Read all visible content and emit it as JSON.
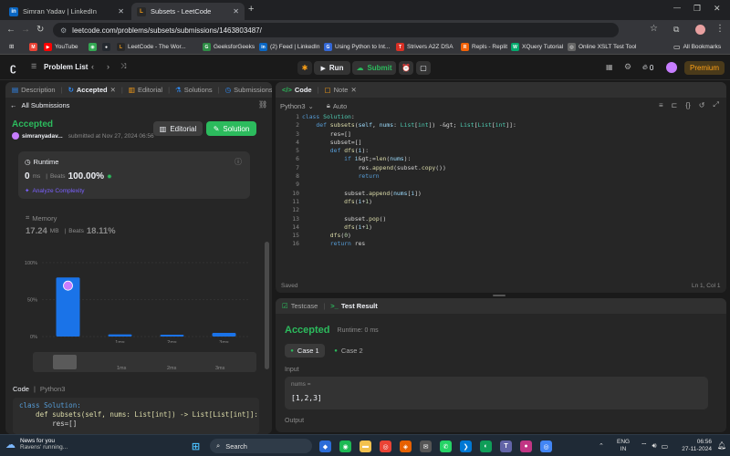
{
  "browser": {
    "tabs": [
      {
        "icon": "in",
        "title": "Simran Yadav | LinkedIn"
      },
      {
        "icon": "leetcode",
        "title": "Subsets - LeetCode"
      }
    ],
    "url": "leetcode.com/problems/subsets/submissions/1463803487/",
    "bookmarks": [
      "YouTube",
      "LeetCode - The Wor...",
      "GeeksforGeeks",
      "(2) Feed | LinkedIn",
      "Using Python to Int...",
      "Strivers A2Z DSA",
      "Repls - Replit",
      "XQuery Tutorial",
      "Online XSLT Test Tool"
    ],
    "all_bookmarks": "All Bookmarks"
  },
  "lcnav": {
    "problem_list": "Problem List",
    "run": "Run",
    "submit": "Submit",
    "streak": "0",
    "premium": "Premium"
  },
  "left_panel": {
    "tabs": [
      "Description",
      "Accepted",
      "Editorial",
      "Solutions",
      "Submissions"
    ],
    "all_submissions": "All Submissions",
    "status": "Accepted",
    "user": "simranyadav...",
    "submitted_at": "submitted at Nov 27, 2024 06:56",
    "editorial_btn": "Editorial",
    "solution_btn": "Solution",
    "runtime": {
      "label": "Runtime",
      "value": "0",
      "unit": "ms",
      "beats_label": "Beats",
      "beats": "100.00%",
      "analyze": "Analyze Complexity"
    },
    "memory": {
      "label": "Memory",
      "value": "17.24",
      "unit": "MB",
      "beats_label": "Beats",
      "beats": "18.11%"
    },
    "code_label": "Code",
    "lang": "Python3",
    "code_preview": [
      "class Solution:",
      "    def subsets(self, nums: List[int]) -> List[List[int]]:",
      "        res=[]"
    ]
  },
  "chart_data": {
    "type": "bar",
    "categories": [
      "",
      "1ms",
      "2ms",
      "3ms"
    ],
    "values": [
      80,
      3,
      2,
      5
    ],
    "ylabel": "",
    "yticks": [
      "100%",
      "50%",
      "0%"
    ],
    "ylim": [
      0,
      100
    ],
    "highlight_index": 0,
    "bar_color": "#1a73e8"
  },
  "minimap": {
    "labels": [
      "1ms",
      "2ms",
      "3ms"
    ]
  },
  "editor": {
    "tab_code": "Code",
    "tab_note": "Note",
    "lang": "Python3",
    "auto": "Auto",
    "saved": "Saved",
    "cursor": "Ln 1, Col 1",
    "lines": [
      "class Solution:",
      "    def subsets(self, nums: List[int]) -> List[List[int]]:",
      "        res=[]",
      "        subset=[]",
      "        def dfs(i):",
      "            if i>=len(nums):",
      "                res.append(subset.copy())",
      "                return",
      "",
      "            subset.append(nums[i])",
      "            dfs(i+1)",
      "",
      "            subset.pop()",
      "            dfs(i+1)",
      "        dfs(0)",
      "        return res"
    ]
  },
  "result": {
    "tab_testcase": "Testcase",
    "tab_result": "Test Result",
    "status": "Accepted",
    "runtime": "Runtime: 0 ms",
    "cases": [
      "Case 1",
      "Case 2"
    ],
    "input_label": "Input",
    "var_name": "nums =",
    "var_value": "[1,2,3]",
    "output_label": "Output"
  },
  "taskbar": {
    "news_title": "News for you",
    "news_sub": "Ravens' running...",
    "search": "Search",
    "lang1": "ENG",
    "lang2": "IN",
    "time": "06:56",
    "date": "27-11-2024"
  },
  "colors": {
    "accent_green": "#2cbb5d",
    "premium": "#ffa116",
    "bar_blue": "#1a73e8"
  }
}
